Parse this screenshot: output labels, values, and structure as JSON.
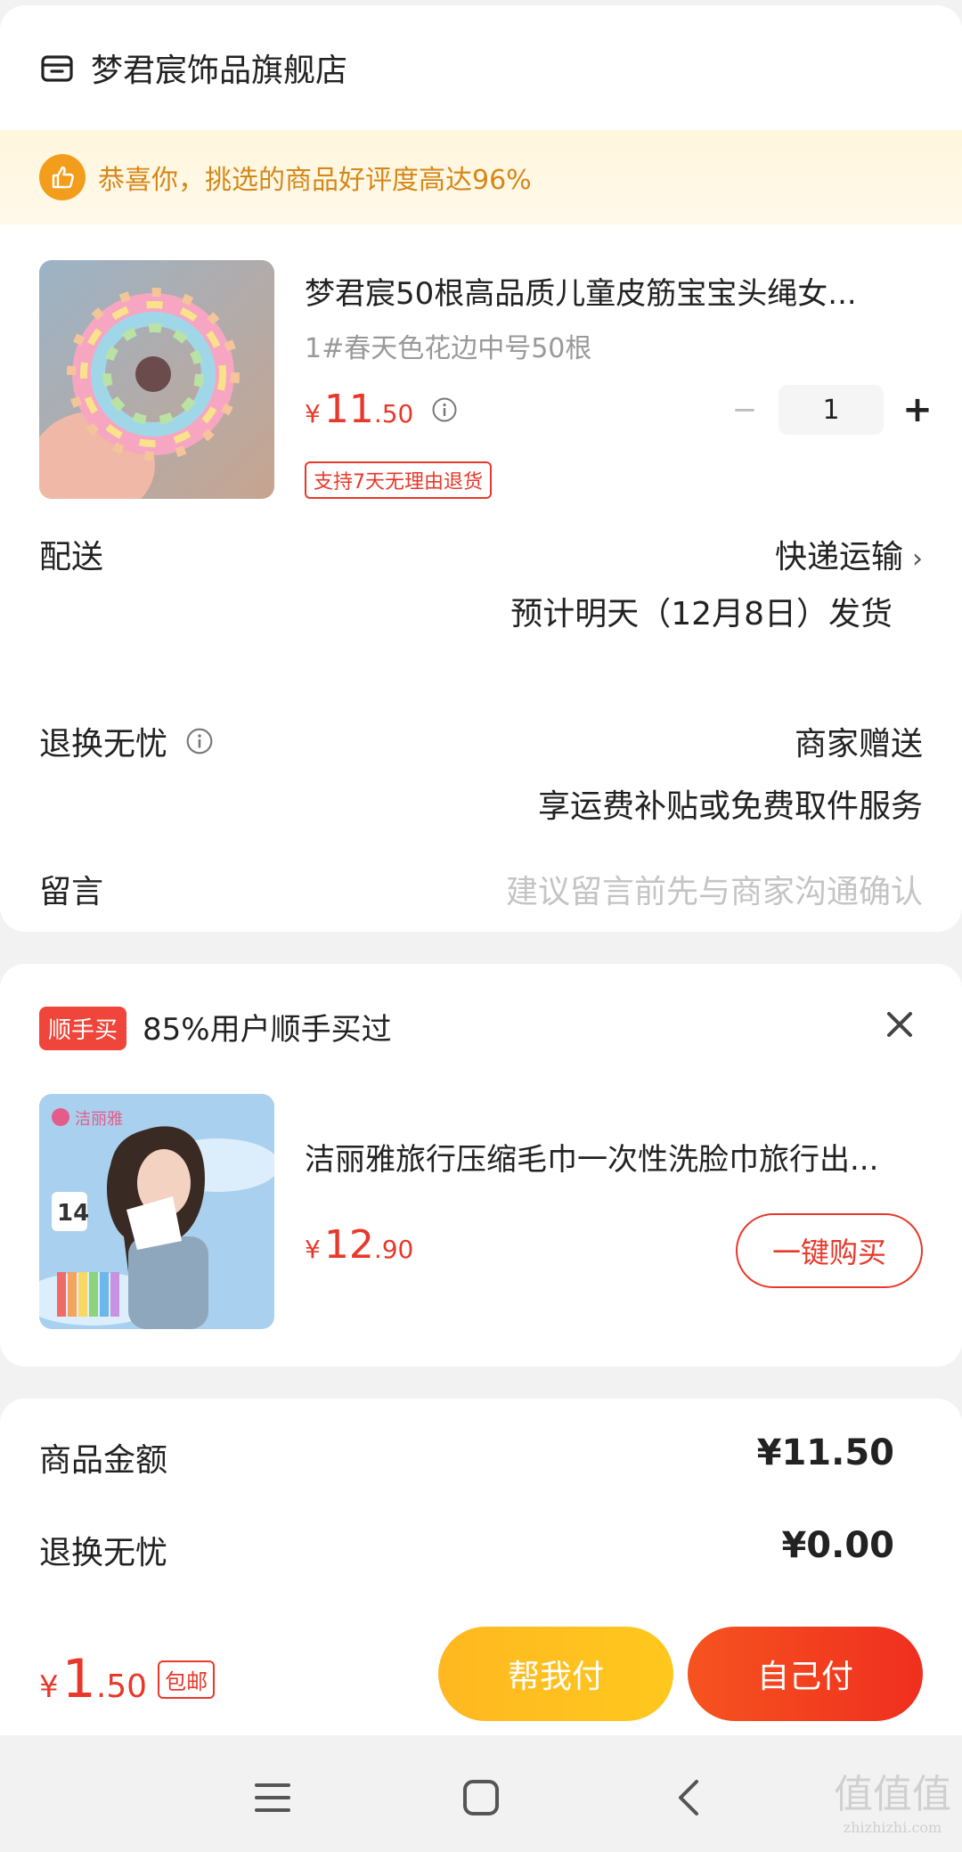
{
  "shop": {
    "name": "梦君宸饰品旗舰店",
    "icon": "store-icon"
  },
  "banner": {
    "text": "恭喜你，挑选的商品好评度高达96%",
    "icon": "thumbs-up-icon"
  },
  "product": {
    "title": "梦君宸50根高品质儿童皮筋宝宝头绳女...",
    "spec": "1#春天色花边中号50根",
    "price_symbol": "¥",
    "price_int": "11",
    "price_dec": ".50",
    "quantity": "1",
    "minus": "−",
    "plus": "+",
    "tag": "支持7天无理由退货"
  },
  "delivery": {
    "label": "配送",
    "method": "快递运输",
    "estimate": "预计明天（12月8日）发货"
  },
  "return_service": {
    "label": "退换无忧",
    "value": "商家赠送",
    "desc": "享运费补贴或免费取件服务"
  },
  "message": {
    "label": "留言",
    "placeholder": "建议留言前先与商家沟通确认"
  },
  "suggest": {
    "tag": "顺手买",
    "text": "85%用户顺手买过",
    "title": "洁丽雅旅行压缩毛巾一次性洗脸巾旅行出...",
    "price_symbol": "¥",
    "price_int": "12",
    "price_dec": ".90",
    "buy_label": "一键购买",
    "img_brand": "洁丽雅",
    "img_count": "14"
  },
  "summary": [
    {
      "label": "商品金额",
      "value": "¥11.50"
    },
    {
      "label": "退换无忧",
      "value": "¥0.00"
    }
  ],
  "bottom": {
    "symbol": "¥",
    "int": "1",
    "dec": ".50",
    "shipping_tag": "包邮",
    "help_pay": "帮我付",
    "self_pay": "自己付"
  },
  "watermark": {
    "main": "值值值",
    "sub": "zhizhizhi.com"
  },
  "colors": {
    "accent": "#e8382b",
    "gold": "#f29e1c",
    "help_btn": "#ffbf1f"
  }
}
